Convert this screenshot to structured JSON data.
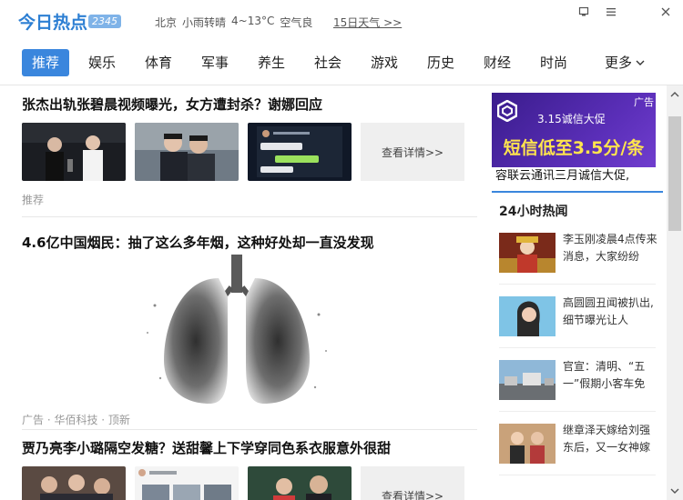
{
  "header": {
    "logo_text": "今日热点",
    "logo_number": "2345",
    "weather": {
      "city": "北京",
      "condition": "小雨转晴",
      "temperature": "4~13°C",
      "air": "空气良"
    },
    "forecast_link": "15日天气 >>"
  },
  "nav": {
    "tabs": [
      "推荐",
      "娱乐",
      "体育",
      "军事",
      "养生",
      "社会",
      "游戏",
      "历史",
      "财经",
      "时尚"
    ],
    "active_tab": "推荐",
    "more_label": "更多"
  },
  "feed": {
    "articles": [
      {
        "title": "张杰出轨张碧晨视频曝光，女方遭封杀？谢娜回应",
        "detail_label": "查看详情>>",
        "meta": "推荐"
      },
      {
        "title": "4.6亿中国烟民：抽了这么多年烟，这种好处却一直没发现",
        "meta": "广告 · 华佰科技 · 顶新"
      },
      {
        "title": "贾乃亮李小璐隔空发糖？送甜馨上下学穿同色系衣服意外很甜",
        "detail_label": "查看详情>>"
      }
    ]
  },
  "sidebar": {
    "ad": {
      "tag": "广告",
      "line1": "3.15诚信大促",
      "line2": "短信低至3.5分/条",
      "line3": "容联云通讯三月诚信大促,"
    },
    "hot_title": "24小时热闻",
    "hot_items": [
      {
        "text": "李玉刚凌晨4点传来消息，大家纷纷"
      },
      {
        "text": "高圆圆丑闻被扒出, 细节曝光让人"
      },
      {
        "text": "官宣：清明、“五一”假期小客车免"
      },
      {
        "text": "继章泽天嫁给刘强东后，又一女神嫁"
      }
    ]
  },
  "colors": {
    "brand_blue": "#3a86dd",
    "ad_purple": "#5b2fb9",
    "ad_yellow": "#ffe44d"
  },
  "icons": [
    "pin-icon",
    "menu-icon",
    "close-icon",
    "chevron-down-icon",
    "scroll-up-icon",
    "scroll-down-icon"
  ]
}
